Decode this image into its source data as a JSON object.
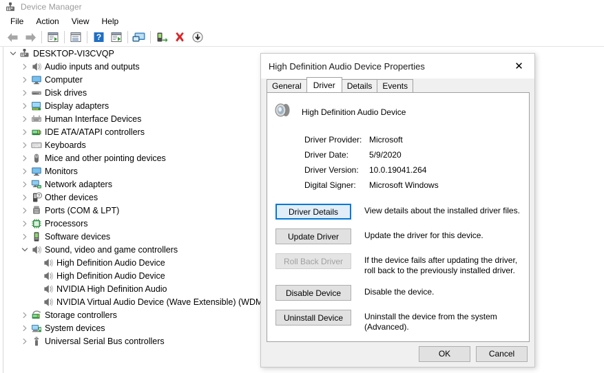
{
  "window": {
    "title": "Device Manager",
    "icon": "device-manager-icon",
    "menus": [
      "File",
      "Action",
      "View",
      "Help"
    ],
    "toolbar": [
      {
        "name": "back-icon"
      },
      {
        "name": "forward-icon"
      },
      {
        "name": "separator"
      },
      {
        "name": "properties-icon"
      },
      {
        "name": "separator"
      },
      {
        "name": "update-driver-icon"
      },
      {
        "name": "separator"
      },
      {
        "name": "help-icon"
      },
      {
        "name": "show-hidden-devices-icon"
      },
      {
        "name": "separator"
      },
      {
        "name": "scan-hardware-changes-icon"
      },
      {
        "name": "separator"
      },
      {
        "name": "enable-device-icon"
      },
      {
        "name": "uninstall-device-icon"
      },
      {
        "name": "disable-device-icon"
      }
    ]
  },
  "tree": [
    {
      "label": "DESKTOP-VI3CVQP",
      "depth": 0,
      "state": "expanded",
      "icon": "computer-root-icon"
    },
    {
      "label": "Audio inputs and outputs",
      "depth": 1,
      "state": "collapsed",
      "icon": "speaker-icon"
    },
    {
      "label": "Computer",
      "depth": 1,
      "state": "collapsed",
      "icon": "monitor-icon"
    },
    {
      "label": "Disk drives",
      "depth": 1,
      "state": "collapsed",
      "icon": "disk-icon"
    },
    {
      "label": "Display adapters",
      "depth": 1,
      "state": "collapsed",
      "icon": "display-adapter-icon"
    },
    {
      "label": "Human Interface Devices",
      "depth": 1,
      "state": "collapsed",
      "icon": "hid-icon"
    },
    {
      "label": "IDE ATA/ATAPI controllers",
      "depth": 1,
      "state": "collapsed",
      "icon": "ide-controller-icon"
    },
    {
      "label": "Keyboards",
      "depth": 1,
      "state": "collapsed",
      "icon": "keyboard-icon"
    },
    {
      "label": "Mice and other pointing devices",
      "depth": 1,
      "state": "collapsed",
      "icon": "mouse-icon"
    },
    {
      "label": "Monitors",
      "depth": 1,
      "state": "collapsed",
      "icon": "monitor-icon"
    },
    {
      "label": "Network adapters",
      "depth": 1,
      "state": "collapsed",
      "icon": "network-adapter-icon"
    },
    {
      "label": "Other devices",
      "depth": 1,
      "state": "collapsed",
      "icon": "unknown-device-icon"
    },
    {
      "label": "Ports (COM & LPT)",
      "depth": 1,
      "state": "collapsed",
      "icon": "port-icon"
    },
    {
      "label": "Processors",
      "depth": 1,
      "state": "collapsed",
      "icon": "processor-icon"
    },
    {
      "label": "Software devices",
      "depth": 1,
      "state": "collapsed",
      "icon": "software-device-icon"
    },
    {
      "label": "Sound, video and game controllers",
      "depth": 1,
      "state": "expanded",
      "icon": "speaker-icon"
    },
    {
      "label": "High Definition Audio Device",
      "depth": 2,
      "state": "leaf",
      "icon": "speaker-icon"
    },
    {
      "label": "High Definition Audio Device",
      "depth": 2,
      "state": "leaf",
      "icon": "speaker-icon"
    },
    {
      "label": "NVIDIA High Definition Audio",
      "depth": 2,
      "state": "leaf",
      "icon": "speaker-icon"
    },
    {
      "label": "NVIDIA Virtual Audio Device (Wave Extensible) (WDM)",
      "depth": 2,
      "state": "leaf",
      "icon": "speaker-icon"
    },
    {
      "label": "Storage controllers",
      "depth": 1,
      "state": "collapsed",
      "icon": "storage-controller-icon"
    },
    {
      "label": "System devices",
      "depth": 1,
      "state": "collapsed",
      "icon": "system-device-icon"
    },
    {
      "label": "Universal Serial Bus controllers",
      "depth": 1,
      "state": "collapsed",
      "icon": "usb-icon"
    }
  ],
  "dialog": {
    "title": "High Definition Audio Device Properties",
    "close_label": "✕",
    "tabs": [
      {
        "label": "General",
        "active": false
      },
      {
        "label": "Driver",
        "active": true
      },
      {
        "label": "Details",
        "active": false
      },
      {
        "label": "Events",
        "active": false
      }
    ],
    "device_name": "High Definition Audio Device",
    "device_icon": "speaker-icon",
    "fields": [
      {
        "label": "Driver Provider:",
        "value": "Microsoft"
      },
      {
        "label": "Driver Date:",
        "value": "5/9/2020"
      },
      {
        "label": "Driver Version:",
        "value": "10.0.19041.264"
      },
      {
        "label": "Digital Signer:",
        "value": "Microsoft Windows"
      }
    ],
    "actions": [
      {
        "label": "Driver Details",
        "description": "View details about the installed driver files.",
        "state": "focused"
      },
      {
        "label": "Update Driver",
        "description": "Update the driver for this device.",
        "state": "enabled"
      },
      {
        "label": "Roll Back Driver",
        "description": "If the device fails after updating the driver, roll back to the previously installed driver.",
        "state": "disabled"
      },
      {
        "label": "Disable Device",
        "description": "Disable the device.",
        "state": "enabled"
      },
      {
        "label": "Uninstall Device",
        "description": "Uninstall the device from the system (Advanced).",
        "state": "enabled"
      }
    ],
    "footer": [
      {
        "label": "OK",
        "name": "ok-button"
      },
      {
        "label": "Cancel",
        "name": "cancel-button"
      }
    ]
  },
  "colors": {
    "accent": "#0078d7",
    "dialog_bg": "#f0f0f0",
    "button_bg": "#e1e1e1",
    "title_text": "#9a9a9a"
  }
}
